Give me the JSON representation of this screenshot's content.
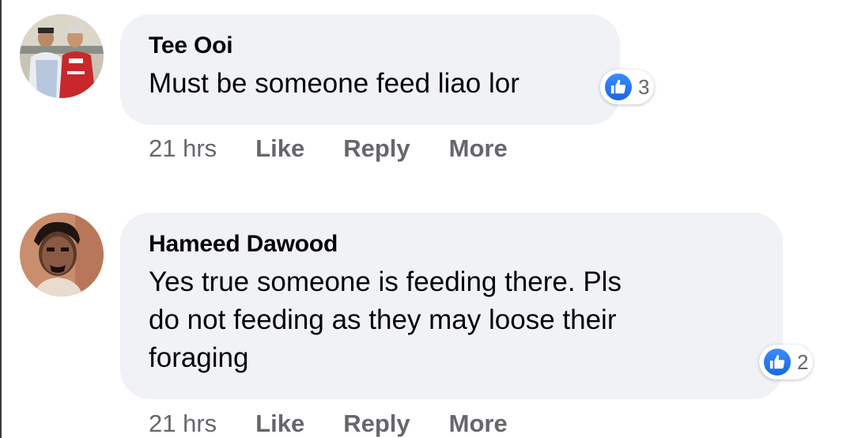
{
  "comments": [
    {
      "author": "Tee Ooi",
      "lines": [
        "Must be someone feed liao lor"
      ],
      "reaction_count": "3",
      "time": "21 hrs",
      "like_label": "Like",
      "reply_label": "Reply",
      "more_label": "More"
    },
    {
      "author": "Hameed Dawood",
      "lines": [
        "Yes true someone is feeding there. Pls",
        "do not feeding as they may loose their",
        "foraging"
      ],
      "reaction_count": "2",
      "time": "21 hrs",
      "like_label": "Like",
      "reply_label": "Reply",
      "more_label": "More"
    }
  ],
  "colors": {
    "bubble": "#f0f2f5",
    "meta_text": "#65676b",
    "like_blue": "#1877f2"
  }
}
